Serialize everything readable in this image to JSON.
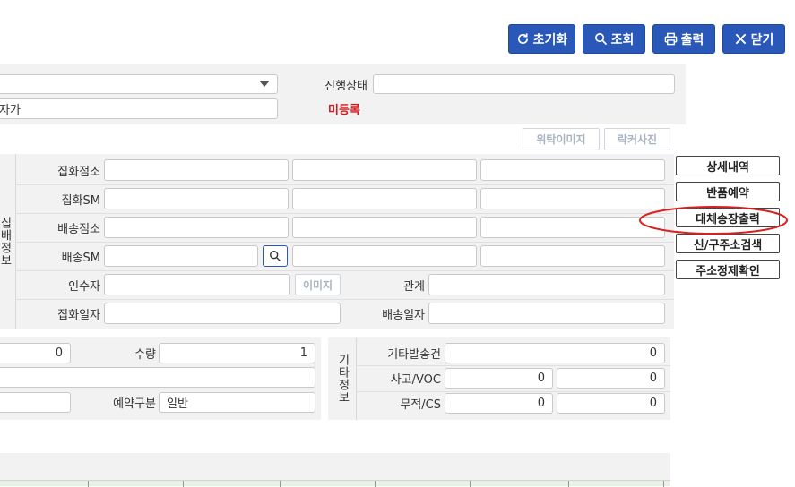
{
  "toolbar": {
    "reset_label": "초기화",
    "search_label": "조회",
    "print_label": "출력",
    "close_label": "닫기"
  },
  "top": {
    "status_label": "진행상태",
    "status_value": "",
    "partial_text": "자가",
    "unregistered_text": "미등록",
    "consign_image_label": "위탁이미지",
    "locker_photo_label": "락커사진"
  },
  "collect_section": {
    "title": "집배정보",
    "rows": [
      {
        "label": "집화점소"
      },
      {
        "label": "집화SM"
      },
      {
        "label": "배송점소"
      },
      {
        "label": "배송SM"
      },
      {
        "label": "인수자"
      },
      {
        "label": "집화일자"
      }
    ],
    "image_button": "이미지",
    "relation_label": "관계",
    "delivery_date_label": "배송일자"
  },
  "side_buttons": {
    "detail": "상세내역",
    "return_reserve": "반품예약",
    "alt_invoice_print": "대체송장출력",
    "address_search": "신/구주소검색",
    "address_confirm": "주소정제확인"
  },
  "quantity_section": {
    "first_value": "0",
    "qty_label": "수량",
    "qty_value": "1",
    "reserve_type_label": "예약구분",
    "reserve_type_value": "일반"
  },
  "etc_section": {
    "title": "기타정보",
    "rows": [
      {
        "label": "기타발송건",
        "v1": "0"
      },
      {
        "label": "사고/VOC",
        "v1": "0",
        "v2": "0"
      },
      {
        "label": "무적/CS",
        "v1": "0",
        "v2": "0"
      }
    ]
  },
  "colors": {
    "primary": "#2a58b8",
    "unregistered": "#d0191c",
    "highlight_circle": "#d92020"
  }
}
